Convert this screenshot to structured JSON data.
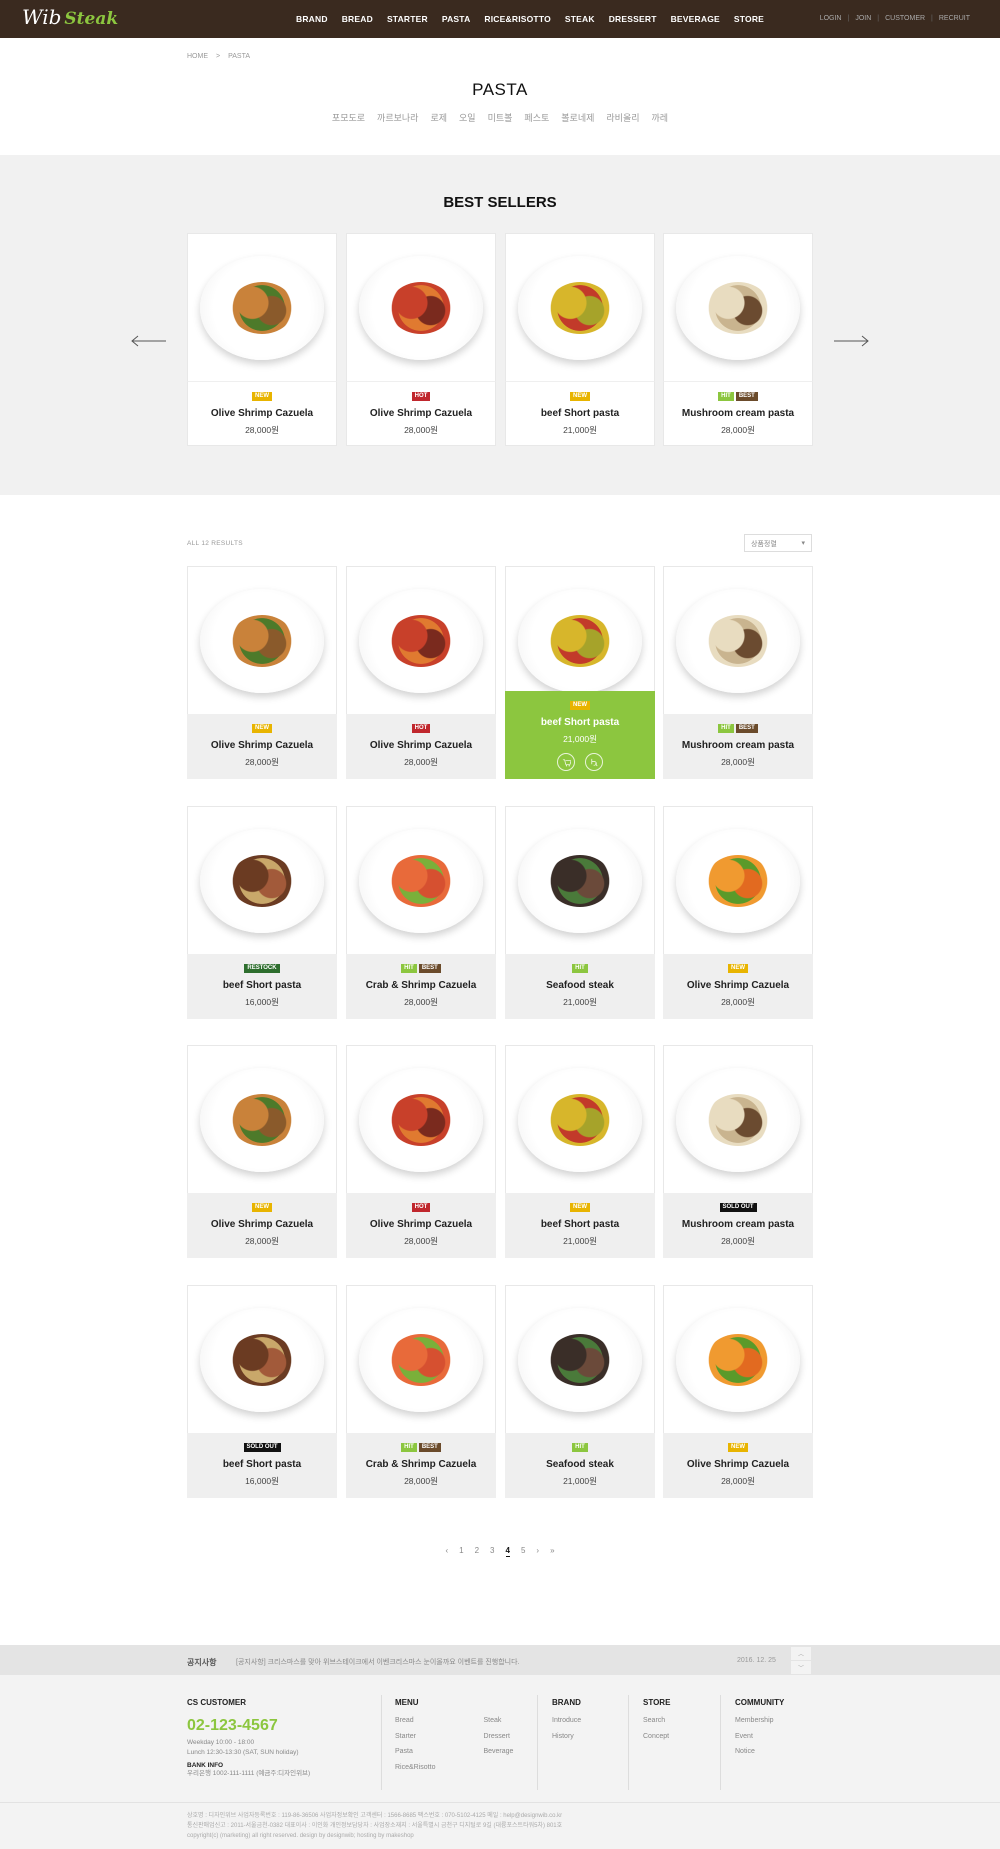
{
  "header": {
    "logo_script": "Wib",
    "logo_bold": "Steak",
    "nav": [
      "BRAND",
      "BREAD",
      "STARTER",
      "PASTA",
      "RICE&RISOTTO",
      "STEAK",
      "DRESSERT",
      "BEVERAGE",
      "STORE"
    ],
    "util": [
      "LOGIN",
      "JOIN",
      "CUSTOMER",
      "RECRUIT"
    ]
  },
  "breadcrumb": [
    "HOME",
    ">",
    "PASTA"
  ],
  "page_title": "PASTA",
  "subcats": [
    "포모도로",
    "까르보나라",
    "로제",
    "오일",
    "미트볼",
    "페스토",
    "볼로네제",
    "라비올리",
    "까레"
  ],
  "best": {
    "title": "BEST SELLERS",
    "items": [
      {
        "name": "Olive Shrimp Cazuela",
        "price": "28,000원",
        "badges": [
          "NEW"
        ],
        "dish": "penne"
      },
      {
        "name": "Olive Shrimp Cazuela",
        "price": "28,000원",
        "badges": [
          "HOT"
        ],
        "dish": "seafood"
      },
      {
        "name": "beef Short pasta",
        "price": "21,000원",
        "badges": [
          "NEW"
        ],
        "dish": "yellow"
      },
      {
        "name": "Mushroom cream pasta",
        "price": "28,000원",
        "badges": [
          "HIT",
          "BEST"
        ],
        "dish": "cream"
      }
    ]
  },
  "list": {
    "results_label": "ALL 12 RESULTS",
    "sort_label": "상품정렬",
    "items": [
      {
        "name": "Olive Shrimp Cazuela",
        "price": "28,000원",
        "badges": [
          "NEW"
        ],
        "dish": "penne"
      },
      {
        "name": "Olive Shrimp Cazuela",
        "price": "28,000원",
        "badges": [
          "HOT"
        ],
        "dish": "seafood"
      },
      {
        "name": "beef Short pasta",
        "price": "21,000원",
        "badges": [
          "NEW"
        ],
        "dish": "yellow"
      },
      {
        "name": "Mushroom cream pasta",
        "price": "28,000원",
        "badges": [
          "HIT",
          "BEST"
        ],
        "dish": "cream"
      },
      {
        "name": "beef Short pasta",
        "price": "16,000원",
        "badges": [
          "RESTOCK"
        ],
        "dish": "beef"
      },
      {
        "name": "Crab & Shrimp Cazuela",
        "price": "28,000원",
        "badges": [
          "HIT",
          "BEST"
        ],
        "dish": "tomato"
      },
      {
        "name": "Seafood steak",
        "price": "21,000원",
        "badges": [
          "HIT"
        ],
        "dish": "steak"
      },
      {
        "name": "Olive Shrimp Cazuela",
        "price": "28,000원",
        "badges": [
          "NEW"
        ],
        "dish": "shrimp"
      },
      {
        "name": "Olive Shrimp Cazuela",
        "price": "28,000원",
        "badges": [
          "NEW"
        ],
        "dish": "penne"
      },
      {
        "name": "Olive Shrimp Cazuela",
        "price": "28,000원",
        "badges": [
          "HOT"
        ],
        "dish": "seafood"
      },
      {
        "name": "beef Short pasta",
        "price": "21,000원",
        "badges": [
          "NEW"
        ],
        "dish": "yellow"
      },
      {
        "name": "Mushroom cream pasta",
        "price": "28,000원",
        "badges": [
          "SOLD OUT"
        ],
        "dish": "cream"
      },
      {
        "name": "beef Short pasta",
        "price": "16,000원",
        "badges": [
          "SOLD OUT"
        ],
        "dish": "beef"
      },
      {
        "name": "Crab & Shrimp Cazuela",
        "price": "28,000원",
        "badges": [
          "HIT",
          "BEST"
        ],
        "dish": "tomato"
      },
      {
        "name": "Seafood steak",
        "price": "21,000원",
        "badges": [
          "HIT"
        ],
        "dish": "steak"
      },
      {
        "name": "Olive Shrimp Cazuela",
        "price": "28,000원",
        "badges": [
          "NEW"
        ],
        "dish": "shrimp"
      }
    ]
  },
  "pagination": {
    "prev": "‹",
    "pages": [
      "1",
      "2",
      "3",
      "4",
      "5"
    ],
    "current": "4",
    "next": "›",
    "last": "»"
  },
  "notice": {
    "label": "공지사항",
    "text": "[공지사항] 크리스마스를 맞아 위브스테이크에서 이벤크리스마스 눈이올까요 이벤트를 진행합니다.",
    "date": "2016. 12. 25"
  },
  "footer": {
    "cs_title": "CS CUSTOMER",
    "phone": "02-123-4567",
    "hours": "Weekday 10:00 - 18:00",
    "lunch": "Lunch 12:30-13:30 (SAT, SUN holiday)",
    "bank_title": "BANK INFO",
    "bank": "우리은행 1002-111-1111 (예금주:디자인위브)",
    "menu_title": "MENU",
    "menu_col1": [
      "Bread",
      "Starter",
      "Pasta",
      "Rice&Risotto"
    ],
    "menu_col2": [
      "Steak",
      "Dressert",
      "Beverage"
    ],
    "brand_title": "BRAND",
    "brand_links": [
      "Introduce",
      "History"
    ],
    "store_title": "STORE",
    "store_links": [
      "Search",
      "Concept"
    ],
    "community_title": "COMMUNITY",
    "community_links": [
      "Membership",
      "Event",
      "Notice"
    ],
    "copy1": "상호명 : 디자인위브   사업자등록번호 : 119-86-36506  사업자정보확인   고객센터 : 1566-8685 팩스번호 : 070-5102-4125 메일 : help@designwib.co.kr",
    "copy2": "통신판매업신고 : 2011-서울금천-0382   대표이사 : 이인화   개인정보담당자 :     사업장소재지 : 서울특별시 금천구 디지털로 9길 (대륭포스트타워5차) 801호",
    "copy3": "copyright(c) (marketing) all right reserved. design by designwib; hosting by makeshop"
  },
  "colors": {
    "topbar": "#3a2a1f",
    "accent": "#8cc63f",
    "hot": "#c0272d",
    "new": "#e8b400",
    "best": "#6b4b2b"
  }
}
